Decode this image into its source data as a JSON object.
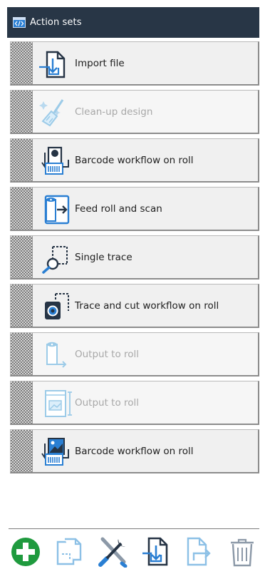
{
  "panel": {
    "title": "Action sets",
    "title_icon": "code-window-icon"
  },
  "colors": {
    "titlebar": "#283646",
    "accent_blue": "#2a7fd3",
    "add_green": "#1f9a3e",
    "icon_dark": "#263445",
    "disabled": "#9ccbe8"
  },
  "actions": [
    {
      "label": "Import file",
      "icon": "import-file-icon",
      "enabled": true
    },
    {
      "label": "Clean-up design",
      "icon": "clean-up-design-icon",
      "enabled": false
    },
    {
      "label": "Barcode workflow on roll",
      "icon": "barcode-workflow-icon",
      "enabled": true
    },
    {
      "label": "Feed roll and scan",
      "icon": "feed-roll-scan-icon",
      "enabled": true
    },
    {
      "label": "Single trace",
      "icon": "single-trace-icon",
      "enabled": true
    },
    {
      "label": "Trace and cut workflow on roll",
      "icon": "trace-cut-workflow-icon",
      "enabled": true
    },
    {
      "label": "Output to roll",
      "icon": "output-to-roll-icon",
      "enabled": false
    },
    {
      "label": "Output to roll",
      "icon": "output-to-roll-image-icon",
      "enabled": false
    },
    {
      "label": "Barcode workflow on roll",
      "icon": "barcode-workflow-image-icon",
      "enabled": true
    }
  ],
  "toolbar": [
    {
      "icon": "add-icon",
      "enabled": true
    },
    {
      "icon": "duplicate-icon",
      "enabled": false
    },
    {
      "icon": "edit-tools-icon",
      "enabled": true
    },
    {
      "icon": "import-icon",
      "enabled": true
    },
    {
      "icon": "export-icon",
      "enabled": false
    },
    {
      "icon": "delete-icon",
      "enabled": false
    }
  ]
}
